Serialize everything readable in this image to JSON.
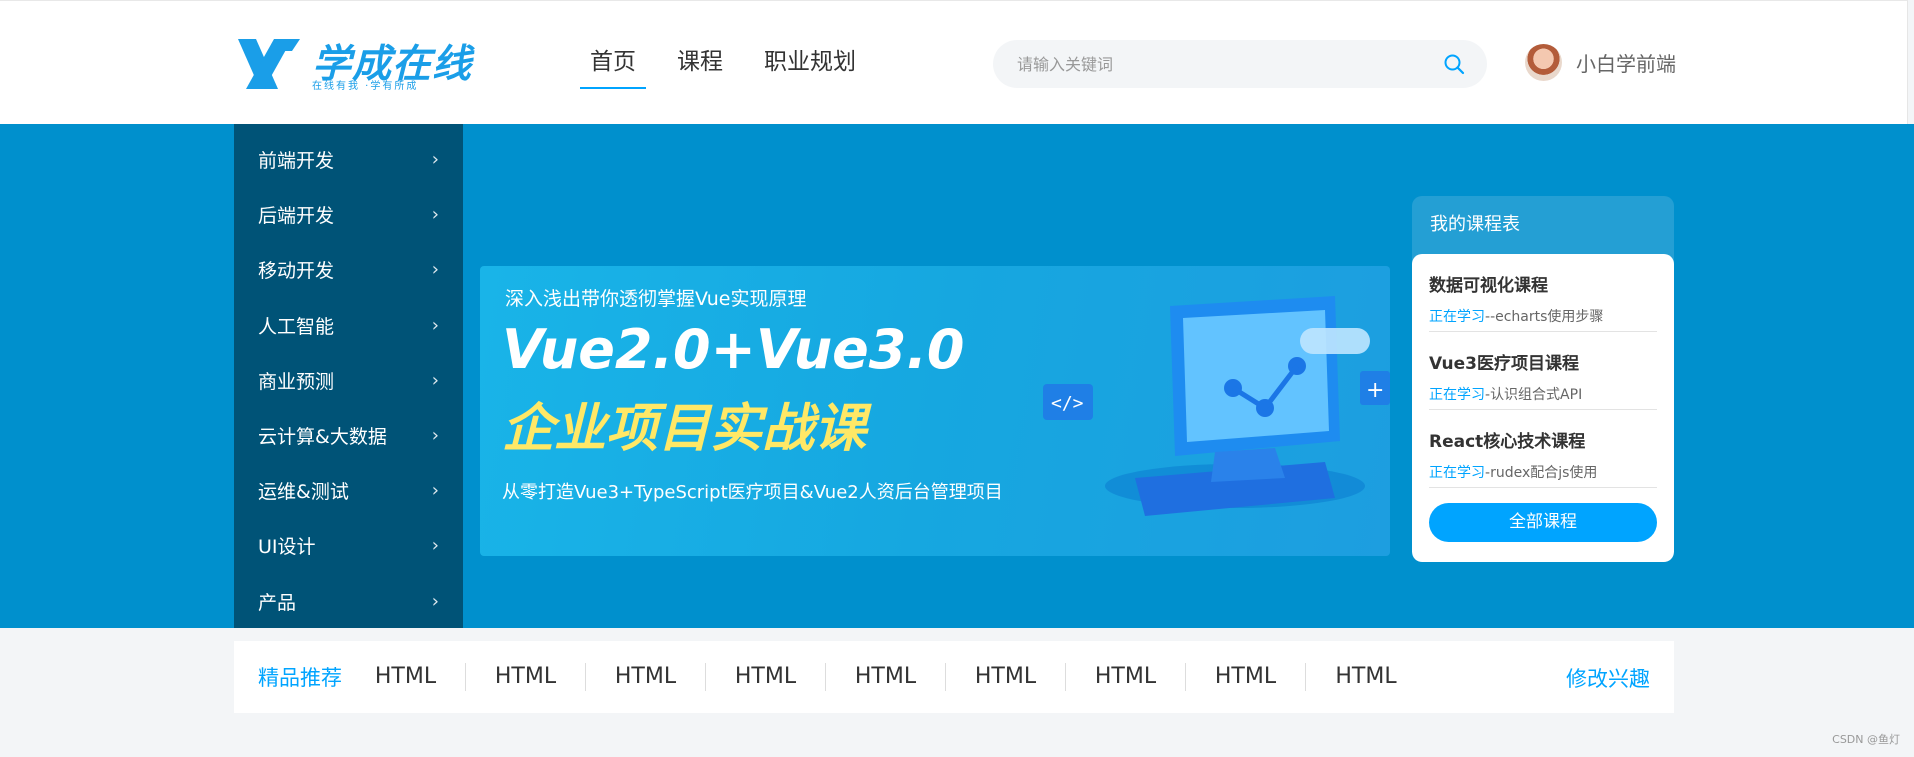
{
  "header": {
    "logo": {
      "text": "学成在线",
      "subtitle": "在线有我 ·学有所成",
      "color": "#1a9ee8"
    },
    "nav": [
      {
        "label": "首页",
        "active": true
      },
      {
        "label": "课程",
        "active": false
      },
      {
        "label": "职业规划",
        "active": false
      }
    ],
    "search": {
      "placeholder": "请输入关键词",
      "icon": "search-icon"
    },
    "user": {
      "name": "小白学前端",
      "avatar": "avatar"
    }
  },
  "sidebar": {
    "items": [
      {
        "label": "前端开发"
      },
      {
        "label": "后端开发"
      },
      {
        "label": "移动开发"
      },
      {
        "label": "人工智能"
      },
      {
        "label": "商业预测"
      },
      {
        "label": "云计算&大数据"
      },
      {
        "label": "运维&测试"
      },
      {
        "label": "UI设计"
      },
      {
        "label": "产品"
      }
    ],
    "chevron": "›"
  },
  "banner": {
    "line1": "深入浅出带你透彻掌握Vue实现原理",
    "title1": "Vue2.0+Vue3.0",
    "title2": "企业项目实战课",
    "line2": "从零打造Vue3+TypeScript医疗项目&Vue2人资后台管理项目",
    "background": "#0090cd"
  },
  "course_card": {
    "title": "我的课程表",
    "courses": [
      {
        "name": "数据可视化课程",
        "status": "正在学习",
        "detail": "-echarts使用步骤",
        "sep": "-"
      },
      {
        "name": "Vue3医疗项目课程",
        "status": "正在学习",
        "detail": "认识组合式API",
        "sep": "-"
      },
      {
        "name": "React核心技术课程",
        "status": "正在学习",
        "detail": "rudex配合js使用",
        "sep": "-"
      }
    ],
    "button_label": "全部课程"
  },
  "recommend": {
    "title": "精品推荐",
    "items": [
      "HTML",
      "HTML",
      "HTML",
      "HTML",
      "HTML",
      "HTML",
      "HTML",
      "HTML",
      "HTML"
    ],
    "edit_label": "修改兴趣",
    "accent": "#00a4ff"
  },
  "watermark": "CSDN @鱼灯"
}
